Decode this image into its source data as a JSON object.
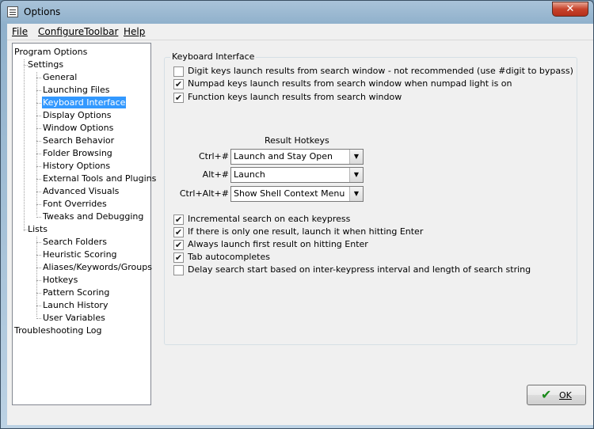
{
  "window": {
    "title": "Options",
    "close_glyph": "✕"
  },
  "menu": [
    {
      "label": "File"
    },
    {
      "label": "ConfigureToolbar"
    },
    {
      "label": "Help"
    }
  ],
  "tree": {
    "root": "Program Options",
    "settings": "Settings",
    "settings_items": [
      "General",
      "Launching Files",
      "Keyboard Interface",
      "Display Options",
      "Window Options",
      "Search Behavior",
      "Folder Browsing",
      "History Options",
      "External Tools and Plugins",
      "Advanced Visuals",
      "Font Overrides",
      "Tweaks and Debugging"
    ],
    "lists": "Lists",
    "lists_items": [
      "Search Folders",
      "Heuristic Scoring",
      "Aliases/Keywords/Groups",
      "Hotkeys",
      "Pattern Scoring",
      "Launch History",
      "User Variables"
    ],
    "troubleshooting": "Troubleshooting Log",
    "selected": "Keyboard Interface"
  },
  "group": {
    "title": "Keyboard Interface",
    "options_top": [
      {
        "label": "Digit keys launch results from search window  - not recommended (use #digit to bypass)",
        "checked": false
      },
      {
        "label": "Numpad keys launch results from search window when numpad light is on",
        "checked": true
      },
      {
        "label": "Function keys launch results from search window",
        "checked": true
      }
    ],
    "hotkeys_title": "Result Hotkeys",
    "hotkeys": [
      {
        "label": "Ctrl+#",
        "value": "Launch and Stay Open"
      },
      {
        "label": "Alt+#",
        "value": "Launch"
      },
      {
        "label": "Ctrl+Alt+#",
        "value": "Show Shell Context Menu"
      }
    ],
    "options_bottom": [
      {
        "label": "Incremental search on each keypress",
        "checked": true
      },
      {
        "label": "If there is only one result, launch it when hitting Enter",
        "checked": true
      },
      {
        "label": "Always launch first result on hitting Enter",
        "checked": true
      },
      {
        "label": "Tab autocompletes",
        "checked": true
      },
      {
        "label": "Delay search start based on inter-keypress interval and length of search string",
        "checked": false
      }
    ]
  },
  "buttons": {
    "ok_label": "OK",
    "ok_icon": "checkmark-icon"
  },
  "glyphs": {
    "check": "✔",
    "dropdown": "▼"
  }
}
